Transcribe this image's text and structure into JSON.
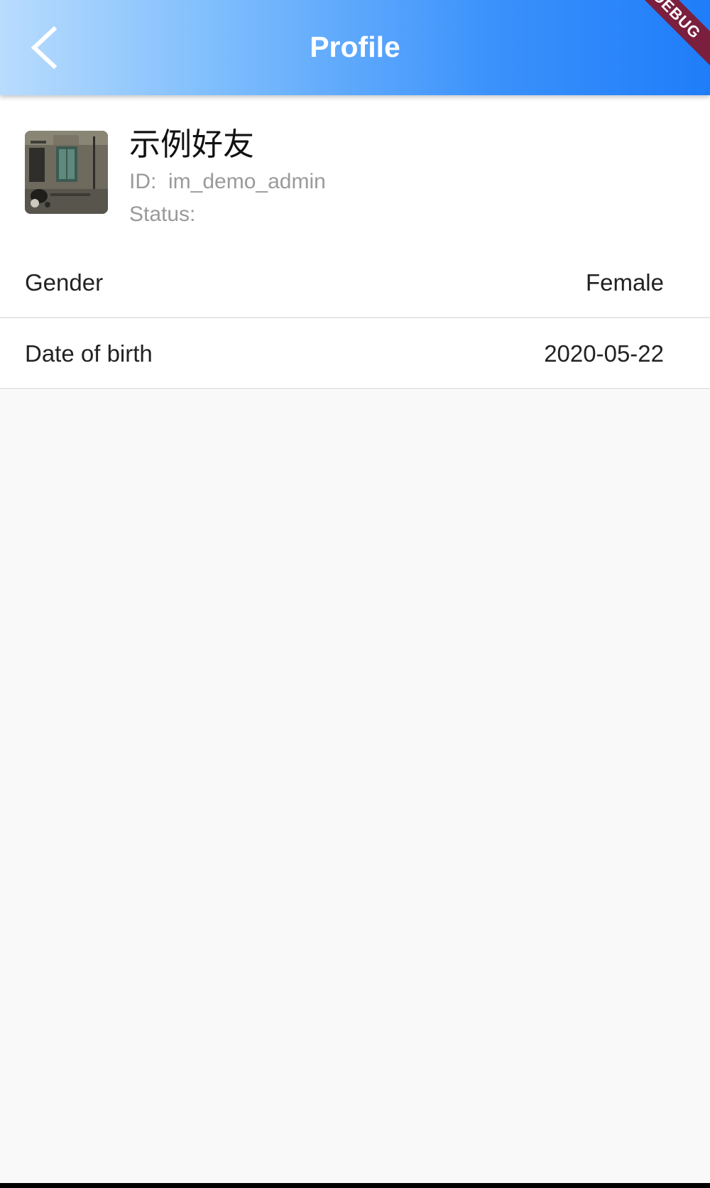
{
  "appbar": {
    "title": "Profile",
    "back_icon": "chevron-left-icon",
    "debug_banner": "DEBUG",
    "gradient_start": "#b9dcfd",
    "gradient_end": "#1f7df9"
  },
  "profile": {
    "name": "示例好友",
    "id_label": "ID:",
    "id_value": "im_demo_admin",
    "status_label": "Status:",
    "status_value": ""
  },
  "details": [
    {
      "label": "Gender",
      "value": "Female"
    },
    {
      "label": "Date of birth",
      "value": "2020-05-22"
    }
  ],
  "colors": {
    "background": "#f9f9f9",
    "card": "#ffffff",
    "divider": "#e6e6e6",
    "secondary_text": "#9a9a9a",
    "banner": "#7b1f3e"
  }
}
